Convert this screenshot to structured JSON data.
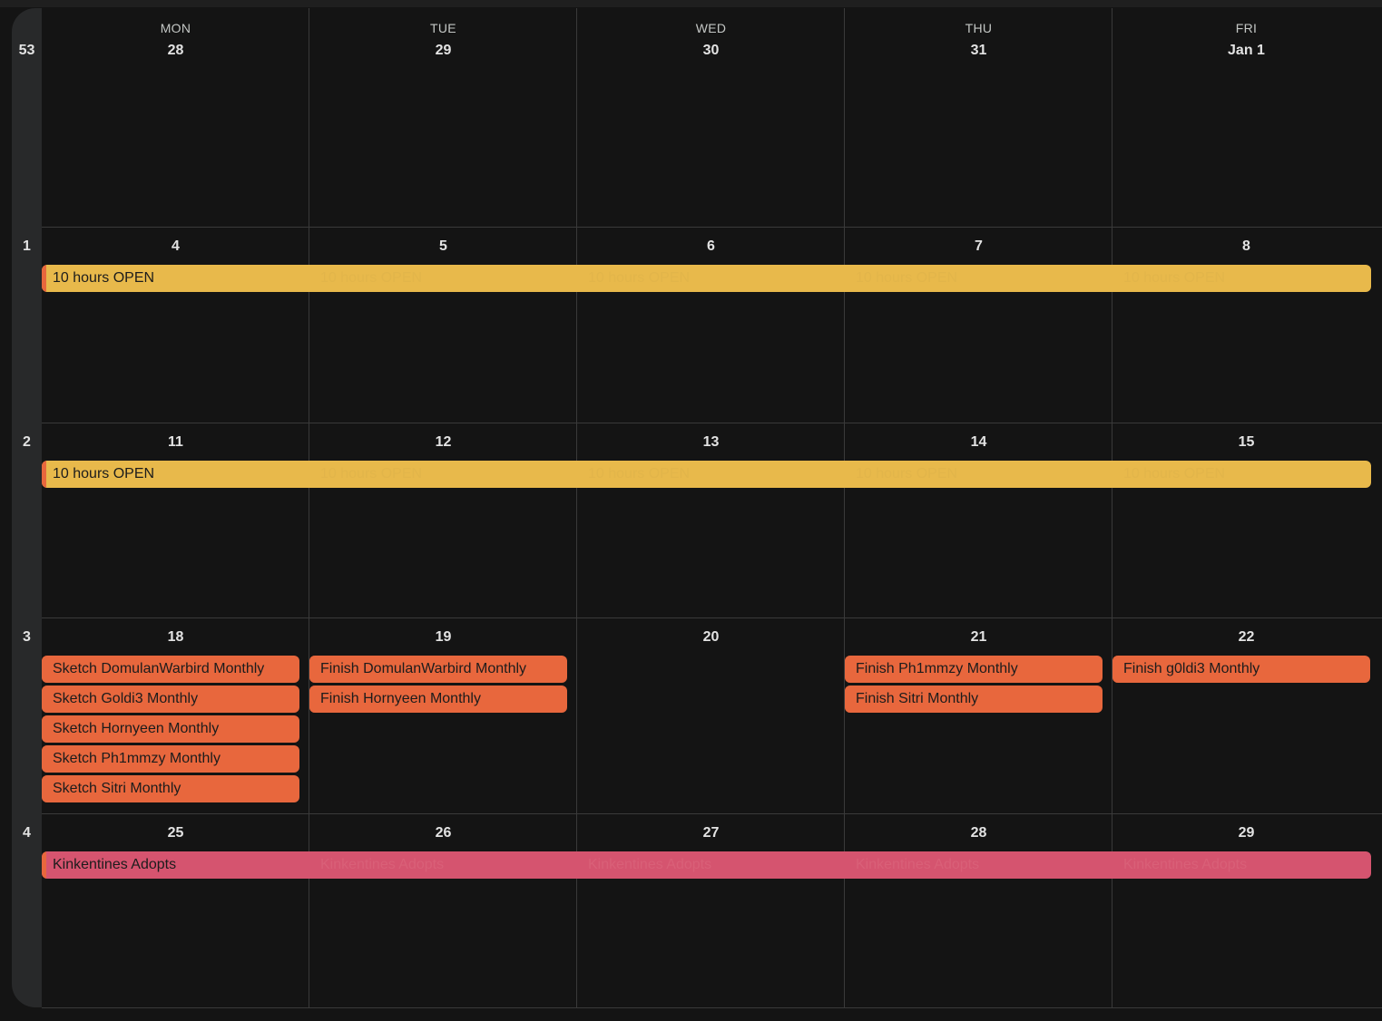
{
  "days_of_week": [
    "MON",
    "TUE",
    "WED",
    "THU",
    "FRI"
  ],
  "weeks": [
    {
      "week_number": "53",
      "dates": [
        "28",
        "29",
        "30",
        "31",
        "Jan 1"
      ]
    },
    {
      "week_number": "1",
      "dates": [
        "4",
        "5",
        "6",
        "7",
        "8"
      ],
      "spanning_event": {
        "title": "10 hours OPEN",
        "color": "#e8b94b",
        "accent": "#e8673d"
      }
    },
    {
      "week_number": "2",
      "dates": [
        "11",
        "12",
        "13",
        "14",
        "15"
      ],
      "spanning_event": {
        "title": "10 hours OPEN",
        "color": "#e8b94b",
        "accent": "#e8673d"
      }
    },
    {
      "week_number": "3",
      "dates": [
        "18",
        "19",
        "20",
        "21",
        "22"
      ],
      "day_events": [
        [
          "Sketch DomulanWarbird Monthly",
          "Sketch Goldi3 Monthly",
          "Sketch Hornyeen Monthly",
          "Sketch Ph1mmzy Monthly",
          "Sketch Sitri Monthly"
        ],
        [
          "Finish DomulanWarbird Monthly",
          "Finish Hornyeen Monthly"
        ],
        [],
        [
          "Finish Ph1mmzy Monthly",
          "Finish Sitri Monthly"
        ],
        [
          "Finish g0ldi3 Monthly"
        ]
      ],
      "event_color": "#e8673d"
    },
    {
      "week_number": "4",
      "dates": [
        "25",
        "26",
        "27",
        "28",
        "29"
      ],
      "spanning_event": {
        "title": "Kinkentines Adopts",
        "color": "#d5546f",
        "accent": "#e8673d"
      }
    }
  ],
  "colors": {
    "background": "#141414",
    "grid_line": "#3a3a3a",
    "week_bar": "#28292a",
    "text": "#e3e3e3"
  }
}
